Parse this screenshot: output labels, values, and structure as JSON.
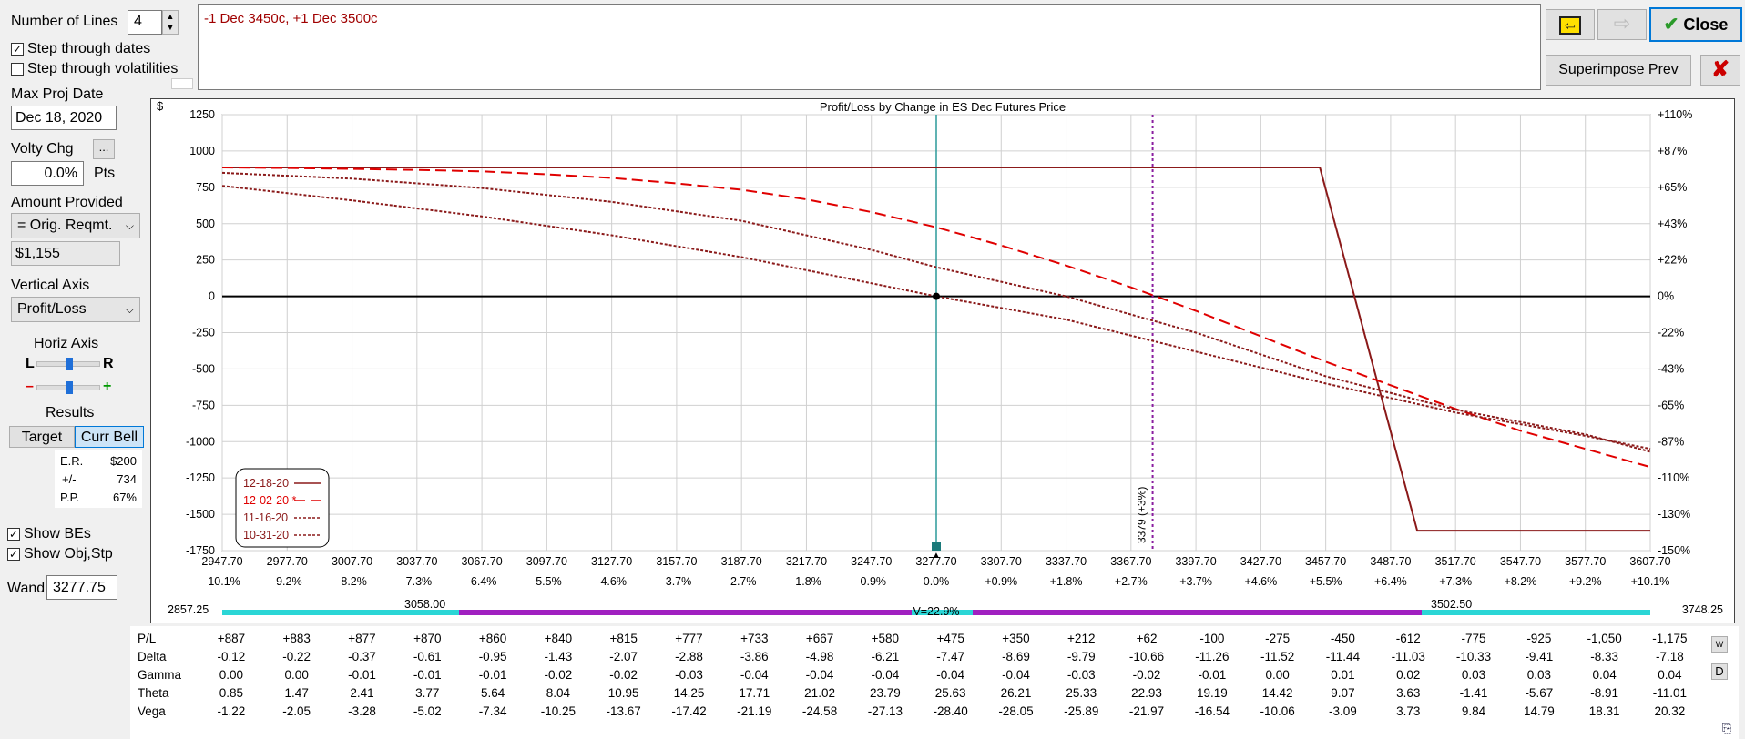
{
  "controls": {
    "num_lines_label": "Number of Lines",
    "num_lines_value": "4",
    "step_dates_label": "Step through dates",
    "step_vols_label": "Step through volatilities",
    "max_proj_label": "Max Proj Date",
    "max_proj_value": "Dec 18, 2020",
    "volty_label": "Volty Chg",
    "volty_button": "...",
    "volty_value": "0.0%",
    "volty_unit": "Pts",
    "amount_label": "Amount Provided",
    "amount_select": "= Orig. Reqmt.",
    "amount_value": "$1,155",
    "vaxis_label": "Vertical Axis",
    "vaxis_select": "Profit/Loss",
    "haxis_label": "Horiz Axis",
    "haxis_l": "L",
    "haxis_r": "R",
    "haxis_minus": "–",
    "haxis_plus": "+",
    "results_label": "Results",
    "target_button": "Target",
    "currbell_button": "Curr Bell",
    "er_label": "E.R.",
    "er_value": "$200",
    "pm_label": "+/-",
    "pm_value": "734",
    "pp_label": "P.P.",
    "pp_value": "67%",
    "show_bes_label": "Show BEs",
    "show_obj_label": "Show Obj,Stp",
    "wand_label": "Wand",
    "wand_value": "3277.75"
  },
  "position_text": "-1 Dec 3450c, +1 Dec 3500c",
  "toolbar": {
    "close_label": "Close",
    "superimpose_label": "Superimpose Prev",
    "back_icon": "arrow-left-icon",
    "forward_icon": "arrow-right-icon",
    "delete_icon": "red-x-icon"
  },
  "chart_data": {
    "type": "line",
    "title": "Profit/Loss by Change in ES Dec Futures Price",
    "ylabel": "$",
    "ylim": [
      -1750,
      1250
    ],
    "yticks": [
      "1250",
      "1000",
      "750",
      "500",
      "250",
      "0",
      "-250",
      "-500",
      "-750",
      "-1000",
      "-1250",
      "-1500",
      "-1750"
    ],
    "right_ticks": [
      "+110%",
      "+87%",
      "+65%",
      "+43%",
      "+22%",
      "0%",
      "-22%",
      "-43%",
      "-65%",
      "-87%",
      "-110%",
      "-130%",
      "-150%"
    ],
    "xlim": [
      2947.7,
      3607.7
    ],
    "x_labels": [
      "2947.70",
      "2977.70",
      "3007.70",
      "3037.70",
      "3067.70",
      "3097.70",
      "3127.70",
      "3157.70",
      "3187.70",
      "3217.70",
      "3247.70",
      "3277.70",
      "3307.70",
      "3337.70",
      "3367.70",
      "3397.70",
      "3427.70",
      "3457.70",
      "3487.70",
      "3517.70",
      "3547.70",
      "3577.70",
      "3607.70"
    ],
    "pct_labels": [
      "-10.1%",
      "-9.2%",
      "-8.2%",
      "-7.3%",
      "-6.4%",
      "-5.5%",
      "-4.6%",
      "-3.7%",
      "-2.7%",
      "-1.8%",
      "-0.9%",
      "0.0%",
      "+0.9%",
      "+1.8%",
      "+2.7%",
      "+3.7%",
      "+4.6%",
      "+5.5%",
      "+6.4%",
      "+7.3%",
      "+8.2%",
      "+9.2%",
      "+10.1%"
    ],
    "current_price": 3277.7,
    "marker_x": 3377.7,
    "marker_label": "3379 (+3%)",
    "series": [
      {
        "name": "12-18-20",
        "style": "solid",
        "color": "#8b1a1a",
        "x": [
          2947.7,
          3455.0,
          3500.0,
          3607.7
        ],
        "y": [
          887,
          887,
          -1613,
          -1613
        ]
      },
      {
        "name": "12-02-20 *",
        "style": "dash",
        "color": "#e00000",
        "x": [
          2947.7,
          2977.7,
          3007.7,
          3037.7,
          3067.7,
          3097.7,
          3127.7,
          3157.7,
          3187.7,
          3217.7,
          3247.7,
          3277.7,
          3307.7,
          3337.7,
          3367.7,
          3397.7,
          3427.7,
          3457.7,
          3487.7,
          3517.7,
          3547.7,
          3577.7,
          3607.7
        ],
        "y": [
          887,
          883,
          877,
          870,
          860,
          840,
          815,
          777,
          733,
          667,
          580,
          475,
          350,
          212,
          62,
          -100,
          -275,
          -450,
          -612,
          -775,
          -925,
          -1050,
          -1175
        ]
      },
      {
        "name": "11-16-20",
        "style": "dot",
        "color": "#8b1a1a",
        "x": [
          2947.7,
          3007.7,
          3067.7,
          3127.7,
          3187.7,
          3247.7,
          3277.7,
          3337.7,
          3397.7,
          3457.7,
          3517.7,
          3577.7,
          3607.7
        ],
        "y": [
          850,
          810,
          745,
          650,
          520,
          320,
          200,
          0,
          -250,
          -550,
          -780,
          -950,
          -1070
        ]
      },
      {
        "name": "10-31-20",
        "style": "dot",
        "color": "#8b1a1a",
        "x": [
          2947.7,
          3007.7,
          3067.7,
          3127.7,
          3187.7,
          3247.7,
          3277.7,
          3337.7,
          3397.7,
          3457.7,
          3517.7,
          3577.7,
          3607.7
        ],
        "y": [
          760,
          660,
          550,
          420,
          270,
          90,
          0,
          -160,
          -380,
          -600,
          -800,
          -960,
          -1050
        ]
      }
    ],
    "bell": {
      "left": "2857.25",
      "left_inner": "3058.00",
      "center_label": "V=22.9%",
      "right_inner": "3502.50",
      "right": "3748.25"
    },
    "legend_placement": "bottom-left"
  },
  "greeks": {
    "rows": [
      {
        "label": "P/L",
        "values": [
          "+887",
          "+883",
          "+877",
          "+870",
          "+860",
          "+840",
          "+815",
          "+777",
          "+733",
          "+667",
          "+580",
          "+475",
          "+350",
          "+212",
          "+62",
          "-100",
          "-275",
          "-450",
          "-612",
          "-775",
          "-925",
          "-1,050",
          "-1,175"
        ]
      },
      {
        "label": "Delta",
        "values": [
          "-0.12",
          "-0.22",
          "-0.37",
          "-0.61",
          "-0.95",
          "-1.43",
          "-2.07",
          "-2.88",
          "-3.86",
          "-4.98",
          "-6.21",
          "-7.47",
          "-8.69",
          "-9.79",
          "-10.66",
          "-11.26",
          "-11.52",
          "-11.44",
          "-11.03",
          "-10.33",
          "-9.41",
          "-8.33",
          "-7.18"
        ]
      },
      {
        "label": "Gamma",
        "values": [
          "0.00",
          "0.00",
          "-0.01",
          "-0.01",
          "-0.01",
          "-0.02",
          "-0.02",
          "-0.03",
          "-0.04",
          "-0.04",
          "-0.04",
          "-0.04",
          "-0.04",
          "-0.03",
          "-0.02",
          "-0.01",
          "0.00",
          "0.01",
          "0.02",
          "0.03",
          "0.03",
          "0.04",
          "0.04"
        ]
      },
      {
        "label": "Theta",
        "values": [
          "0.85",
          "1.47",
          "2.41",
          "3.77",
          "5.64",
          "8.04",
          "10.95",
          "14.25",
          "17.71",
          "21.02",
          "23.79",
          "25.63",
          "26.21",
          "25.33",
          "22.93",
          "19.19",
          "14.42",
          "9.07",
          "3.63",
          "-1.41",
          "-5.67",
          "-8.91",
          "-11.01"
        ]
      },
      {
        "label": "Vega",
        "values": [
          "-1.22",
          "-2.05",
          "-3.28",
          "-5.02",
          "-7.34",
          "-10.25",
          "-13.67",
          "-17.42",
          "-21.19",
          "-24.58",
          "-27.13",
          "-28.40",
          "-28.05",
          "-25.89",
          "-21.97",
          "-16.54",
          "-10.06",
          "-3.09",
          "3.73",
          "9.84",
          "14.79",
          "18.31",
          "20.32"
        ]
      }
    ],
    "w_button": "W",
    "d_button": "D"
  }
}
